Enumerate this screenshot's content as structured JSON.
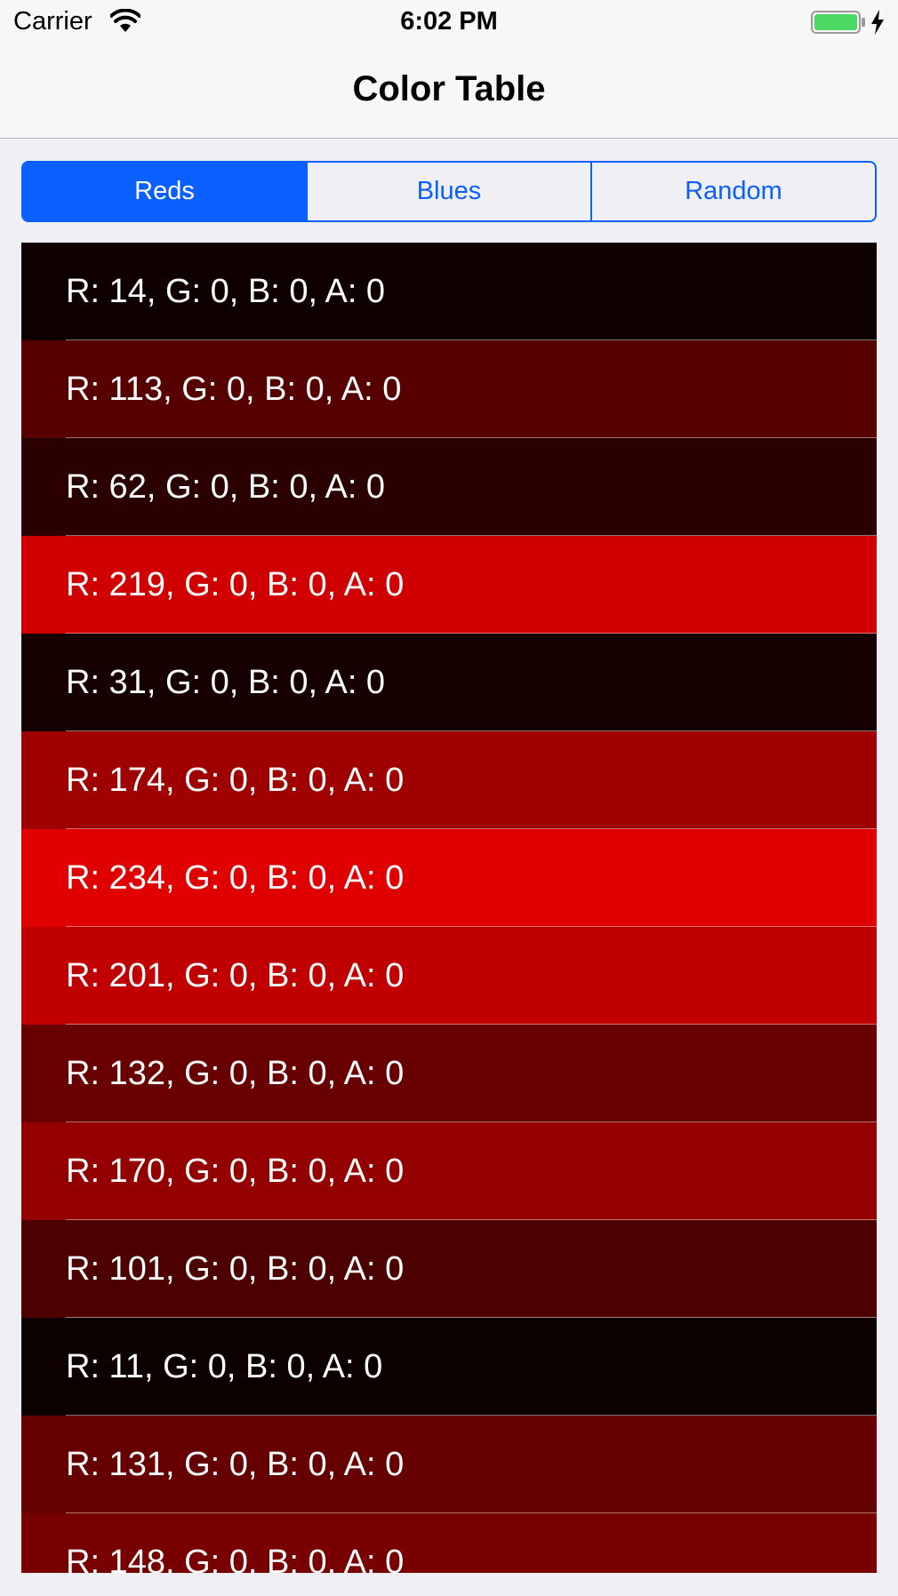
{
  "status_bar": {
    "carrier": "Carrier",
    "time": "6:02 PM",
    "icons": [
      "wifi-icon",
      "battery-icon",
      "charging-bolt-icon"
    ],
    "battery_color": "#4cd964"
  },
  "nav": {
    "title": "Color Table"
  },
  "segmented": {
    "accent": "#0a60fe",
    "segments": [
      {
        "label": "Reds",
        "selected": true
      },
      {
        "label": "Blues",
        "selected": false
      },
      {
        "label": "Random",
        "selected": false
      }
    ]
  },
  "table": {
    "rows": [
      {
        "label": "R: 14, G: 0, B: 0, A: 0",
        "color": "#0e0000"
      },
      {
        "label": "R: 113, G: 0, B: 0, A: 0",
        "color": "#560000"
      },
      {
        "label": "R: 62, G: 0, B: 0, A: 0",
        "color": "#2a0000"
      },
      {
        "label": "R: 219, G: 0, B: 0, A: 0",
        "color": "#d00000"
      },
      {
        "label": "R: 31, G: 0, B: 0, A: 0",
        "color": "#160000"
      },
      {
        "label": "R: 174, G: 0, B: 0, A: 0",
        "color": "#9f0000"
      },
      {
        "label": "R: 234, G: 0, B: 0, A: 0",
        "color": "#e10000"
      },
      {
        "label": "R: 201, G: 0, B: 0, A: 0",
        "color": "#c00000"
      },
      {
        "label": "R: 132, G: 0, B: 0, A: 0",
        "color": "#680000"
      },
      {
        "label": "R: 170, G: 0, B: 0, A: 0",
        "color": "#940000"
      },
      {
        "label": "R: 101, G: 0, B: 0, A: 0",
        "color": "#4c0000"
      },
      {
        "label": "R: 11, G: 0, B: 0, A: 0",
        "color": "#0c0000"
      },
      {
        "label": "R: 131, G: 0, B: 0, A: 0",
        "color": "#660000"
      },
      {
        "label": "R: 148, G: 0, B: 0, A: 0",
        "color": "#780000"
      }
    ]
  }
}
